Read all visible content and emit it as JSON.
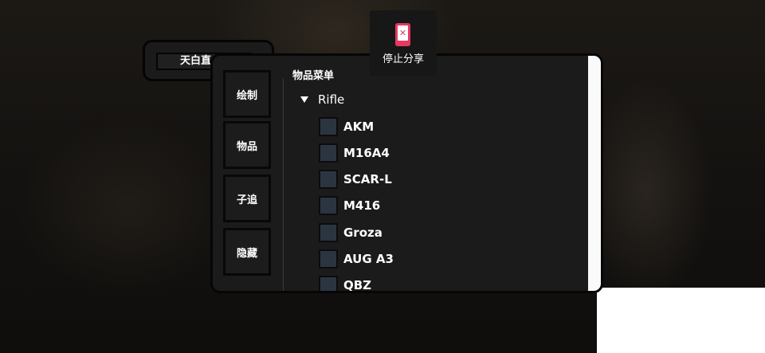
{
  "title_tab": {
    "text": "天白直"
  },
  "sidebar": {
    "buttons": [
      {
        "label": "绘制"
      },
      {
        "label": "物品"
      },
      {
        "label": "子追"
      },
      {
        "label": "隐藏"
      }
    ]
  },
  "menu": {
    "title": "物品菜单",
    "category": {
      "name": "Rifle",
      "expanded": true,
      "icon": "triangle-down-icon"
    },
    "items": [
      {
        "label": "AKM",
        "checked": false
      },
      {
        "label": "M16A4",
        "checked": false
      },
      {
        "label": "SCAR-L",
        "checked": false
      },
      {
        "label": "M416",
        "checked": false
      },
      {
        "label": "Groza",
        "checked": false
      },
      {
        "label": "AUG A3",
        "checked": false
      },
      {
        "label": "QBZ",
        "checked": false
      }
    ]
  },
  "share": {
    "label": "停止分享",
    "icon": "phone-stop-icon",
    "accent": "#e53962"
  },
  "colors": {
    "checkbox": "#2b3541",
    "panel": "#1b1b1b"
  }
}
